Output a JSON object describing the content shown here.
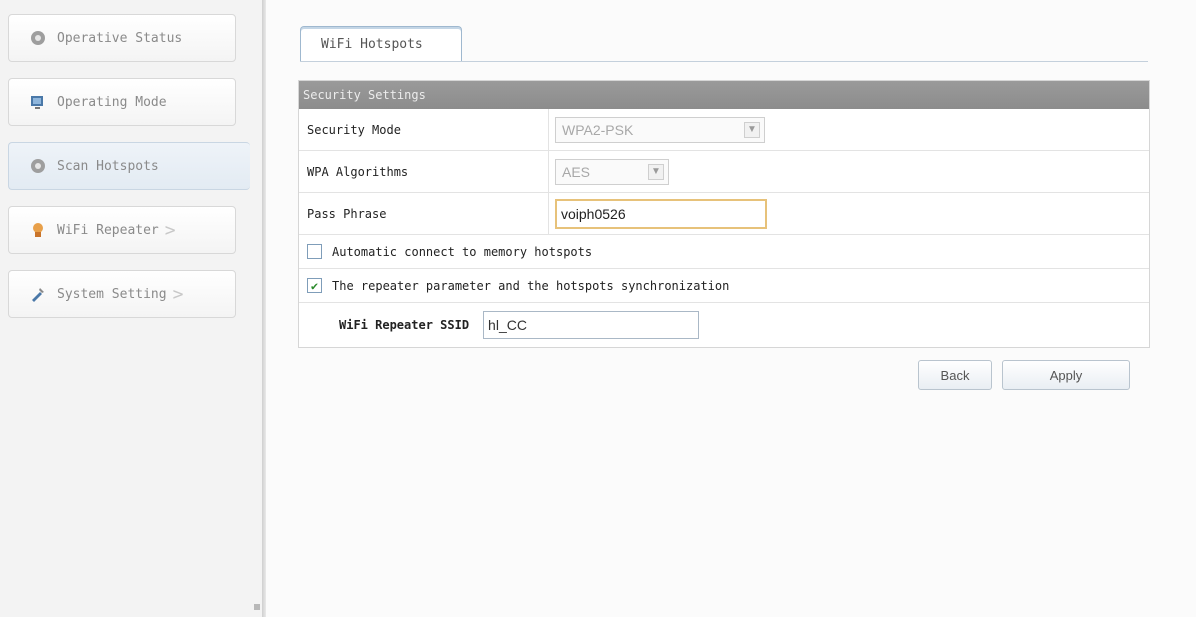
{
  "sidebar": {
    "items": [
      {
        "label": "Operative Status",
        "icon": "gear-icon"
      },
      {
        "label": "Operating Mode",
        "icon": "monitor-icon"
      },
      {
        "label": "Scan Hotspots",
        "icon": "gear-icon"
      },
      {
        "label": "WiFi Repeater",
        "icon": "repeater-icon",
        "chevron": ">"
      },
      {
        "label": "System Setting",
        "icon": "tools-icon",
        "chevron": ">"
      }
    ]
  },
  "tab": {
    "label": "WiFi Hotspots"
  },
  "panel": {
    "title": "Security Settings",
    "security_mode": {
      "label": "Security Mode",
      "value": "WPA2-PSK"
    },
    "wpa_algorithms": {
      "label": "WPA Algorithms",
      "value": "AES"
    },
    "pass_phrase": {
      "label": "Pass Phrase",
      "value": "voiph0526"
    },
    "auto_connect": {
      "label": "Automatic connect to memory hotspots",
      "checked": false
    },
    "sync": {
      "label": "The repeater parameter and the hotspots synchronization",
      "checked": true
    },
    "ssid": {
      "label": "WiFi Repeater SSID",
      "value": "hl_CC"
    }
  },
  "buttons": {
    "back": "Back",
    "apply": "Apply"
  }
}
